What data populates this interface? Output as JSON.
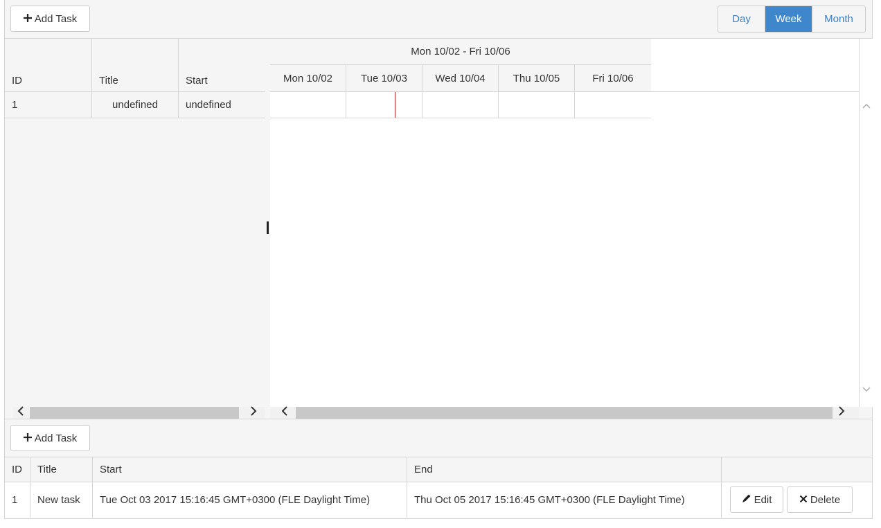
{
  "toolbar": {
    "add_task_label": "Add Task",
    "views": [
      "Day",
      "Week",
      "Month"
    ],
    "active_view": "Week"
  },
  "tree": {
    "columns": [
      "ID",
      "Title",
      "Start"
    ],
    "rows": [
      {
        "id": "1",
        "title": "undefined",
        "start": "undefined"
      }
    ]
  },
  "timeline": {
    "range_label": "Mon 10/02 - Fri 10/06",
    "days": [
      "Mon 10/02",
      "Tue 10/03",
      "Wed 10/04",
      "Thu 10/05",
      "Fri 10/06"
    ]
  },
  "grid": {
    "add_task_label": "Add Task",
    "columns": [
      "ID",
      "Title",
      "Start",
      "End",
      ""
    ],
    "rows": [
      {
        "id": "1",
        "title": "New task",
        "start": "Tue Oct 03 2017 15:16:45 GMT+0300 (FLE Daylight Time)",
        "end": "Thu Oct 05 2017 15:16:45 GMT+0300 (FLE Daylight Time)",
        "edit_label": "Edit",
        "delete_label": "Delete"
      }
    ]
  },
  "colors": {
    "accent": "#3f87cc",
    "today_marker": "#c0272d"
  }
}
